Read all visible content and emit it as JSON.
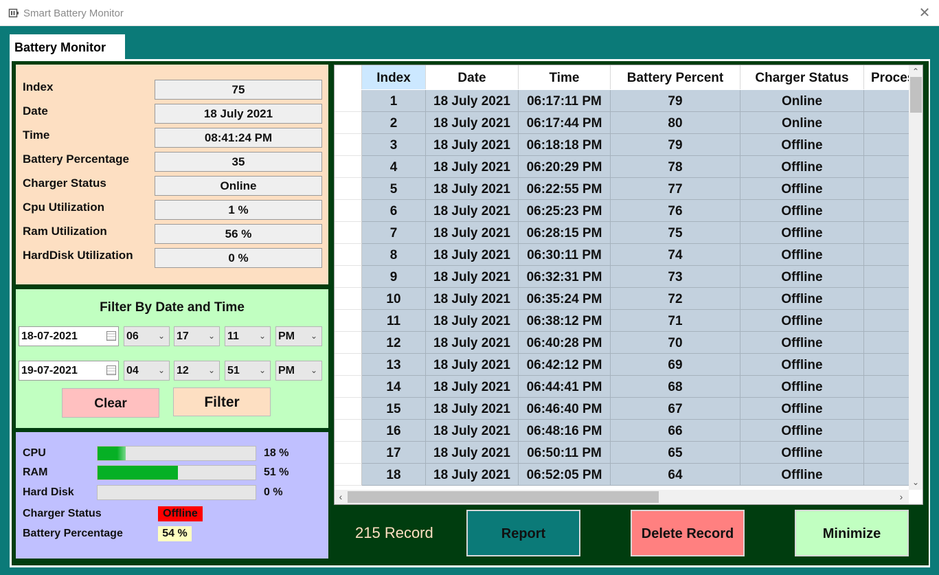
{
  "window": {
    "title": "Smart Battery Monitor",
    "close_glyph": "✕"
  },
  "tab": {
    "label": "Battery Monitor"
  },
  "info": [
    {
      "label": "Index",
      "value": "75"
    },
    {
      "label": "Date",
      "value": "18 July 2021"
    },
    {
      "label": "Time",
      "value": "08:41:24 PM"
    },
    {
      "label": "Battery Percentage",
      "value": "35"
    },
    {
      "label": "Charger Status",
      "value": "Online"
    },
    {
      "label": "Cpu Utilization",
      "value": "1 %"
    },
    {
      "label": "Ram Utilization",
      "value": "56 %"
    },
    {
      "label": "HardDisk Utilization",
      "value": "0 %"
    }
  ],
  "filter": {
    "title": "Filter By Date and Time",
    "from": {
      "date": "18-07-2021",
      "hour": "06",
      "minute": "17",
      "second": "11",
      "ampm": "PM"
    },
    "to": {
      "date": "19-07-2021",
      "hour": "04",
      "minute": "12",
      "second": "51",
      "ampm": "PM"
    },
    "clear_label": "Clear",
    "filter_label": "Filter"
  },
  "system": {
    "cpu": {
      "label": "CPU",
      "percent": 18,
      "text": "18 %"
    },
    "ram": {
      "label": "RAM",
      "percent": 51,
      "text": "51 %"
    },
    "disk": {
      "label": "Hard Disk",
      "percent": 0,
      "text": "0 %"
    },
    "charger": {
      "label": "Charger Status",
      "value": "Offline",
      "color": "#ff0000"
    },
    "battery": {
      "label": "Battery Percentage",
      "value": "54 %"
    }
  },
  "grid": {
    "columns": [
      "Index",
      "Date",
      "Time",
      "Battery Percent",
      "Charger Status",
      "Process"
    ],
    "rows": [
      [
        "1",
        "18 July 2021",
        "06:17:11 PM",
        "79",
        "Online"
      ],
      [
        "2",
        "18 July 2021",
        "06:17:44 PM",
        "80",
        "Online"
      ],
      [
        "3",
        "18 July 2021",
        "06:18:18 PM",
        "79",
        "Offline"
      ],
      [
        "4",
        "18 July 2021",
        "06:20:29 PM",
        "78",
        "Offline"
      ],
      [
        "5",
        "18 July 2021",
        "06:22:55 PM",
        "77",
        "Offline"
      ],
      [
        "6",
        "18 July 2021",
        "06:25:23 PM",
        "76",
        "Offline"
      ],
      [
        "7",
        "18 July 2021",
        "06:28:15 PM",
        "75",
        "Offline"
      ],
      [
        "8",
        "18 July 2021",
        "06:30:11 PM",
        "74",
        "Offline"
      ],
      [
        "9",
        "18 July 2021",
        "06:32:31 PM",
        "73",
        "Offline"
      ],
      [
        "10",
        "18 July 2021",
        "06:35:24 PM",
        "72",
        "Offline"
      ],
      [
        "11",
        "18 July 2021",
        "06:38:12 PM",
        "71",
        "Offline"
      ],
      [
        "12",
        "18 July 2021",
        "06:40:28 PM",
        "70",
        "Offline"
      ],
      [
        "13",
        "18 July 2021",
        "06:42:12 PM",
        "69",
        "Offline"
      ],
      [
        "14",
        "18 July 2021",
        "06:44:41 PM",
        "68",
        "Offline"
      ],
      [
        "15",
        "18 July 2021",
        "06:46:40 PM",
        "67",
        "Offline"
      ],
      [
        "16",
        "18 July 2021",
        "06:48:16 PM",
        "66",
        "Offline"
      ],
      [
        "17",
        "18 July 2021",
        "06:50:11 PM",
        "65",
        "Offline"
      ],
      [
        "18",
        "18 July 2021",
        "06:52:05 PM",
        "64",
        "Offline"
      ]
    ]
  },
  "footer": {
    "record_count": "215 Record",
    "report_label": "Report",
    "delete_label": "Delete Record",
    "minimize_label": "Minimize"
  },
  "colors": {
    "background": "#0b7a78",
    "inner_panel": "#003d0f",
    "info_panel": "#fddfc2",
    "filter_panel": "#c1ffc1",
    "system_panel": "#c0c0ff",
    "progress": "#06b025",
    "report_button": "#0b7a78",
    "delete_button": "#ff8080",
    "minimize_button": "#c1ffc1"
  }
}
